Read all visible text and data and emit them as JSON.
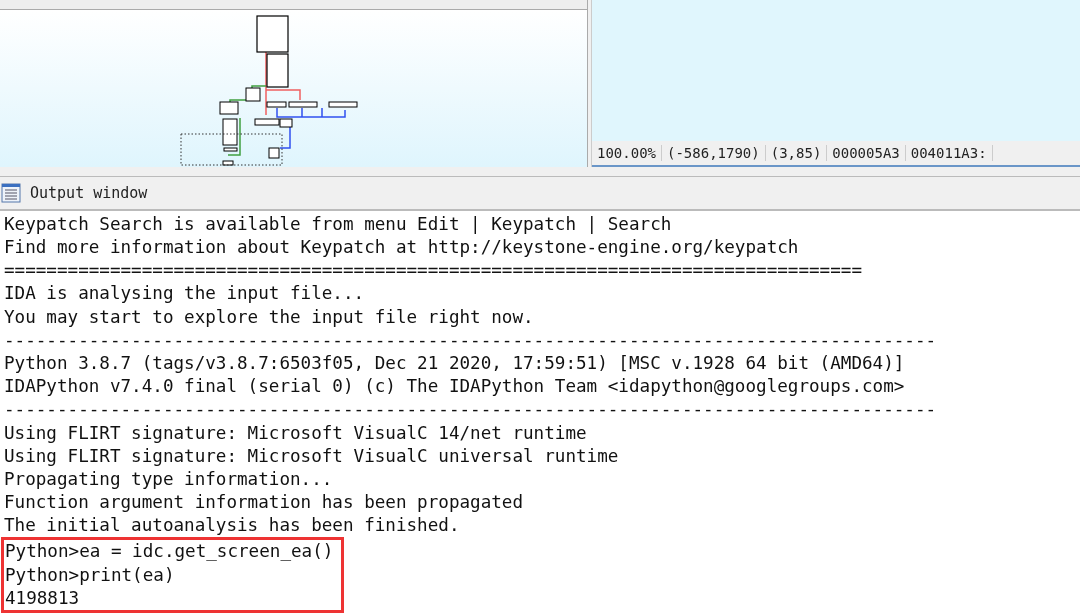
{
  "status_bar": [
    "100.00%",
    "(-586,1790)",
    "(3,85)",
    "000005A3",
    "004011A3:"
  ],
  "output_window": {
    "title": "Output window",
    "lines": [
      "Keypatch Search is available from menu Edit | Keypatch | Search",
      "Find more information about Keypatch at http://keystone-engine.org/keypatch",
      "=================================================================================",
      "IDA is analysing the input file...",
      "You may start to explore the input file right now.",
      "----------------------------------------------------------------------------------------",
      "Python 3.8.7 (tags/v3.8.7:6503f05, Dec 21 2020, 17:59:51) [MSC v.1928 64 bit (AMD64)]",
      "IDAPython v7.4.0 final (serial 0) (c) The IDAPython Team <idapython@googlegroups.com>",
      "----------------------------------------------------------------------------------------",
      "Using FLIRT signature: Microsoft VisualC 14/net runtime",
      "Using FLIRT signature: Microsoft VisualC universal runtime",
      "Propagating type information...",
      "Function argument information has been propagated",
      "The initial autoanalysis has been finished."
    ],
    "highlighted_lines": [
      "Python>ea = idc.get_screen_ea()",
      "Python>print(ea)",
      "4198813"
    ]
  }
}
